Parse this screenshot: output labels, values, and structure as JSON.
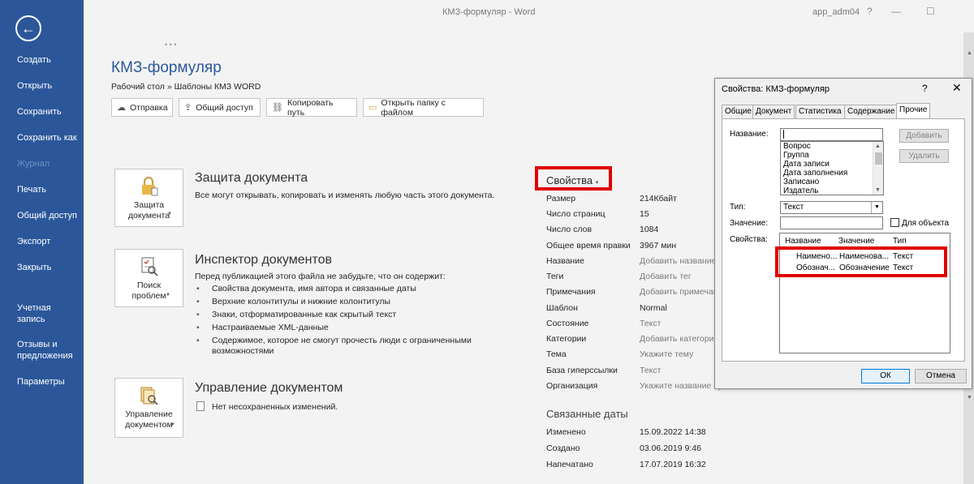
{
  "window": {
    "title": "КМЗ-формуляр  -  Word",
    "user": "app_adm04",
    "help": "?",
    "minimize": "—",
    "maximize": "☐"
  },
  "sidebar": {
    "back_icon": "arrow-left-icon",
    "items": [
      {
        "label": "Создать"
      },
      {
        "label": "Открыть"
      },
      {
        "label": "Сохранить"
      },
      {
        "label": "Сохранить как"
      },
      {
        "label": "Журнал"
      },
      {
        "label": "Печать"
      },
      {
        "label": "Общий доступ"
      },
      {
        "label": "Экспорт"
      },
      {
        "label": "Закрыть"
      },
      {
        "label": "Учетная запись"
      },
      {
        "label": "Отзывы и предложения"
      },
      {
        "label": "Параметры"
      }
    ]
  },
  "document": {
    "title": "КМЗ-формуляр",
    "breadcrumb": "Рабочий стол » Шаблоны КМЗ WORD"
  },
  "toolbar": {
    "upload": "Отправка",
    "share": "Общий доступ",
    "copy_path": "Копировать путь",
    "open_folder": "Открыть папку с файлом"
  },
  "protect": {
    "button": "Защита документа",
    "title": "Защита документа",
    "description": "Все могут открывать, копировать и изменять любую часть этого документа."
  },
  "inspect": {
    "button": "Поиск проблем",
    "title": "Инспектор документов",
    "description": "Перед публикацией этого файла не забудьте, что он содержит:",
    "bullets": [
      "Свойства документа, имя автора и связанные даты",
      "Верхние колонтитулы и нижние колонтитулы",
      "Знаки, отформатированные как скрытый текст",
      "Настраиваемые XML-данные",
      "Содержимое, которое не смогут прочесть люди с ограниченными возможностями"
    ]
  },
  "manage": {
    "button": "Управление документом",
    "title": "Управление документом",
    "status": "Нет несохраненных изменений."
  },
  "properties": {
    "header": "Свойства",
    "rows": [
      {
        "label": "Размер",
        "value": "214Кбайт"
      },
      {
        "label": "Число страниц",
        "value": "15"
      },
      {
        "label": "Число слов",
        "value": "1084"
      },
      {
        "label": "Общее время правки",
        "value": "3967 мин"
      },
      {
        "label": "Название",
        "value": "Добавить название"
      },
      {
        "label": "Теги",
        "value": "Добавить тег"
      },
      {
        "label": "Примечания",
        "value": "Добавить примечан"
      },
      {
        "label": "Шаблон",
        "value": "Normal"
      },
      {
        "label": "Состояние",
        "value": "Текст"
      },
      {
        "label": "Категории",
        "value": "Добавить категорию"
      },
      {
        "label": "Тема",
        "value": "Укажите тему"
      },
      {
        "label": "База гиперссылки",
        "value": "Текст"
      },
      {
        "label": "Организация",
        "value": "Укажите название ор"
      }
    ],
    "related_title": "Связанные даты",
    "dates": [
      {
        "label": "Изменено",
        "value": "15.09.2022 14:38"
      },
      {
        "label": "Создано",
        "value": "03.06.2019 9:46"
      },
      {
        "label": "Напечатано",
        "value": "17.07.2019 16:32"
      }
    ]
  },
  "dialog": {
    "title": "Свойства: КМЗ-формуляр",
    "help": "?",
    "close": "✕",
    "tabs": [
      "Общие",
      "Документ",
      "Статистика",
      "Содержание",
      "Прочие"
    ],
    "name_label": "Название:",
    "name_value": "",
    "name_options": [
      "Вопрос",
      "Группа",
      "Дата записи",
      "Дата заполнения",
      "Записано",
      "Издатель"
    ],
    "add_button": "Добавить",
    "delete_button": "Удалить",
    "type_label": "Тип:",
    "type_value": "Текст",
    "value_label": "Значение:",
    "value_value": "",
    "link_label": "Для объекта",
    "props_label": "Свойства:",
    "table_headers": [
      "Название",
      "Значение",
      "Тип"
    ],
    "table_rows": [
      {
        "name": "Наимено...",
        "value": "Наименова...",
        "type": "Текст"
      },
      {
        "name": "Обознач...",
        "value": "Обозначение",
        "type": "Текст"
      }
    ],
    "ok": "ОК",
    "cancel": "Отмена"
  },
  "colors": {
    "accent": "#2b579a",
    "highlight": "#e00000"
  }
}
